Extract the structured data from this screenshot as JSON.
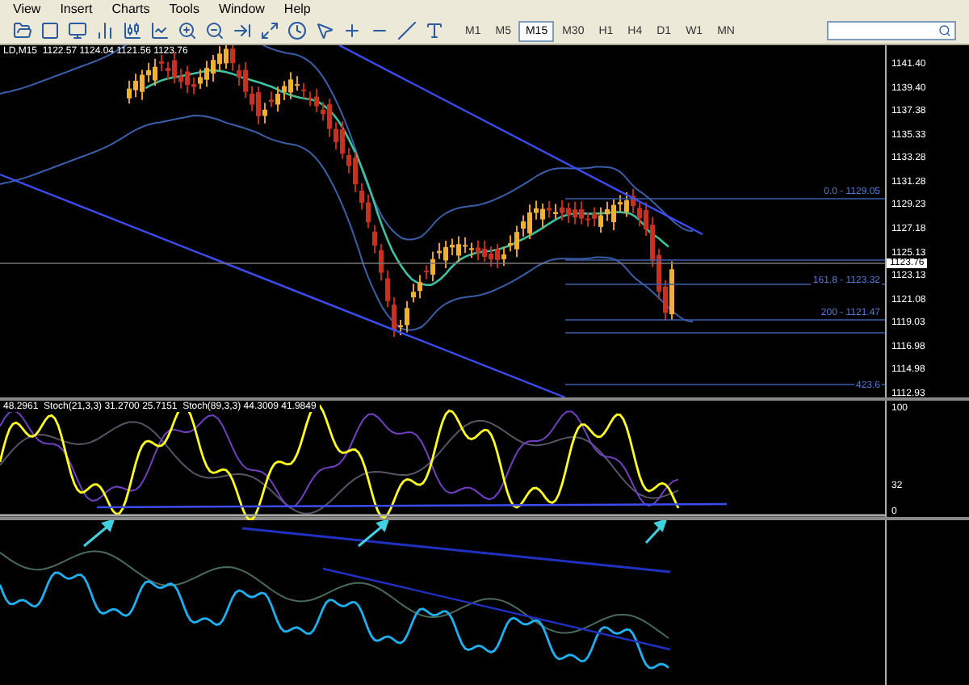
{
  "menu": [
    "View",
    "Insert",
    "Charts",
    "Tools",
    "Window",
    "Help"
  ],
  "timeframes": [
    {
      "label": "M1",
      "selected": false
    },
    {
      "label": "M5",
      "selected": false
    },
    {
      "label": "M15",
      "selected": true
    },
    {
      "label": "M30",
      "selected": false
    },
    {
      "label": "H1",
      "selected": false
    },
    {
      "label": "H4",
      "selected": false
    },
    {
      "label": "D1",
      "selected": false
    },
    {
      "label": "W1",
      "selected": false
    },
    {
      "label": "MN",
      "selected": false
    }
  ],
  "main_chart": {
    "header": "LD,M15  1122.57 1124.04 1121.56 1123.76",
    "price_labels": [
      "1141.40",
      "1139.40",
      "1137.38",
      "1135.33",
      "1133.28",
      "1131.28",
      "1129.23",
      "1127.18",
      "1125.13",
      "1123.13",
      "1121.08",
      "1119.03",
      "1116.98",
      "1114.98",
      "1112.93"
    ],
    "current_price": "1123.76",
    "fibo_labels": [
      "0.0 - 1129.05",
      "161.8 - 1123.32",
      "200 - 1121.47",
      "423.6"
    ]
  },
  "indicator_1": {
    "header": "48.2961  Stoch(21,3,3) 31.2700 25.7151  Stoch(89,3,3) 44.3009 41.9849",
    "scale_labels": [
      "100",
      "32",
      "0"
    ]
  }
}
